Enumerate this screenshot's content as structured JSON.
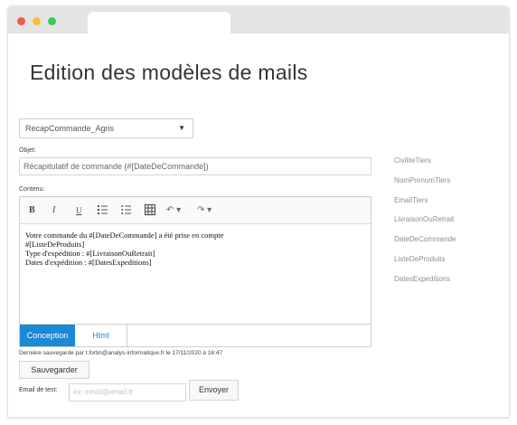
{
  "page": {
    "title": "Edition des modèles de mails"
  },
  "template_select": {
    "value": "RecapCommande_Agris",
    "caret": "▼"
  },
  "objet": {
    "label": "Objet:",
    "value": "Récapitulatif de commande (#[DateDeCommande])"
  },
  "contenu": {
    "label": "Contenu:",
    "toolbar": {
      "bold": "B",
      "italic": "I",
      "underline": "U",
      "undo": "↶ ▾",
      "redo": "↷ ▾"
    },
    "lines": [
      "Votre commande du #[DateDeCommande] a été prise en compte",
      "#[ListeDeProduits]",
      "Type d'expédition : #[LivraisonOuRetrait]",
      "Dates d'expédition : #[DatesExpeditions]"
    ]
  },
  "mode_tabs": {
    "conception": "Conception",
    "html": "Html"
  },
  "last_saved": "Dernière sauvegarde par t.fortin@analys-informatique.fr le 17/11/2020 à 16:47",
  "save_button": "Sauvegarder",
  "test_email": {
    "label": "Email de test:",
    "placeholder": "ex: email@email.fr",
    "send_button": "Envoyer"
  },
  "fields": [
    "CiviliteTiers",
    "NomPrenomTiers",
    "EmailTiers",
    "LivraisonOuRetrait",
    "DateDeCommande",
    "ListeDeProduits",
    "DatesExpeditions"
  ],
  "colors": {
    "accent": "#1c88d8",
    "titlebar": "#e4e4e4",
    "dot_red": "#f25a4c",
    "dot_yellow": "#f7bf3c",
    "dot_green": "#3ccb52",
    "field_text": "#8f8f8f"
  }
}
